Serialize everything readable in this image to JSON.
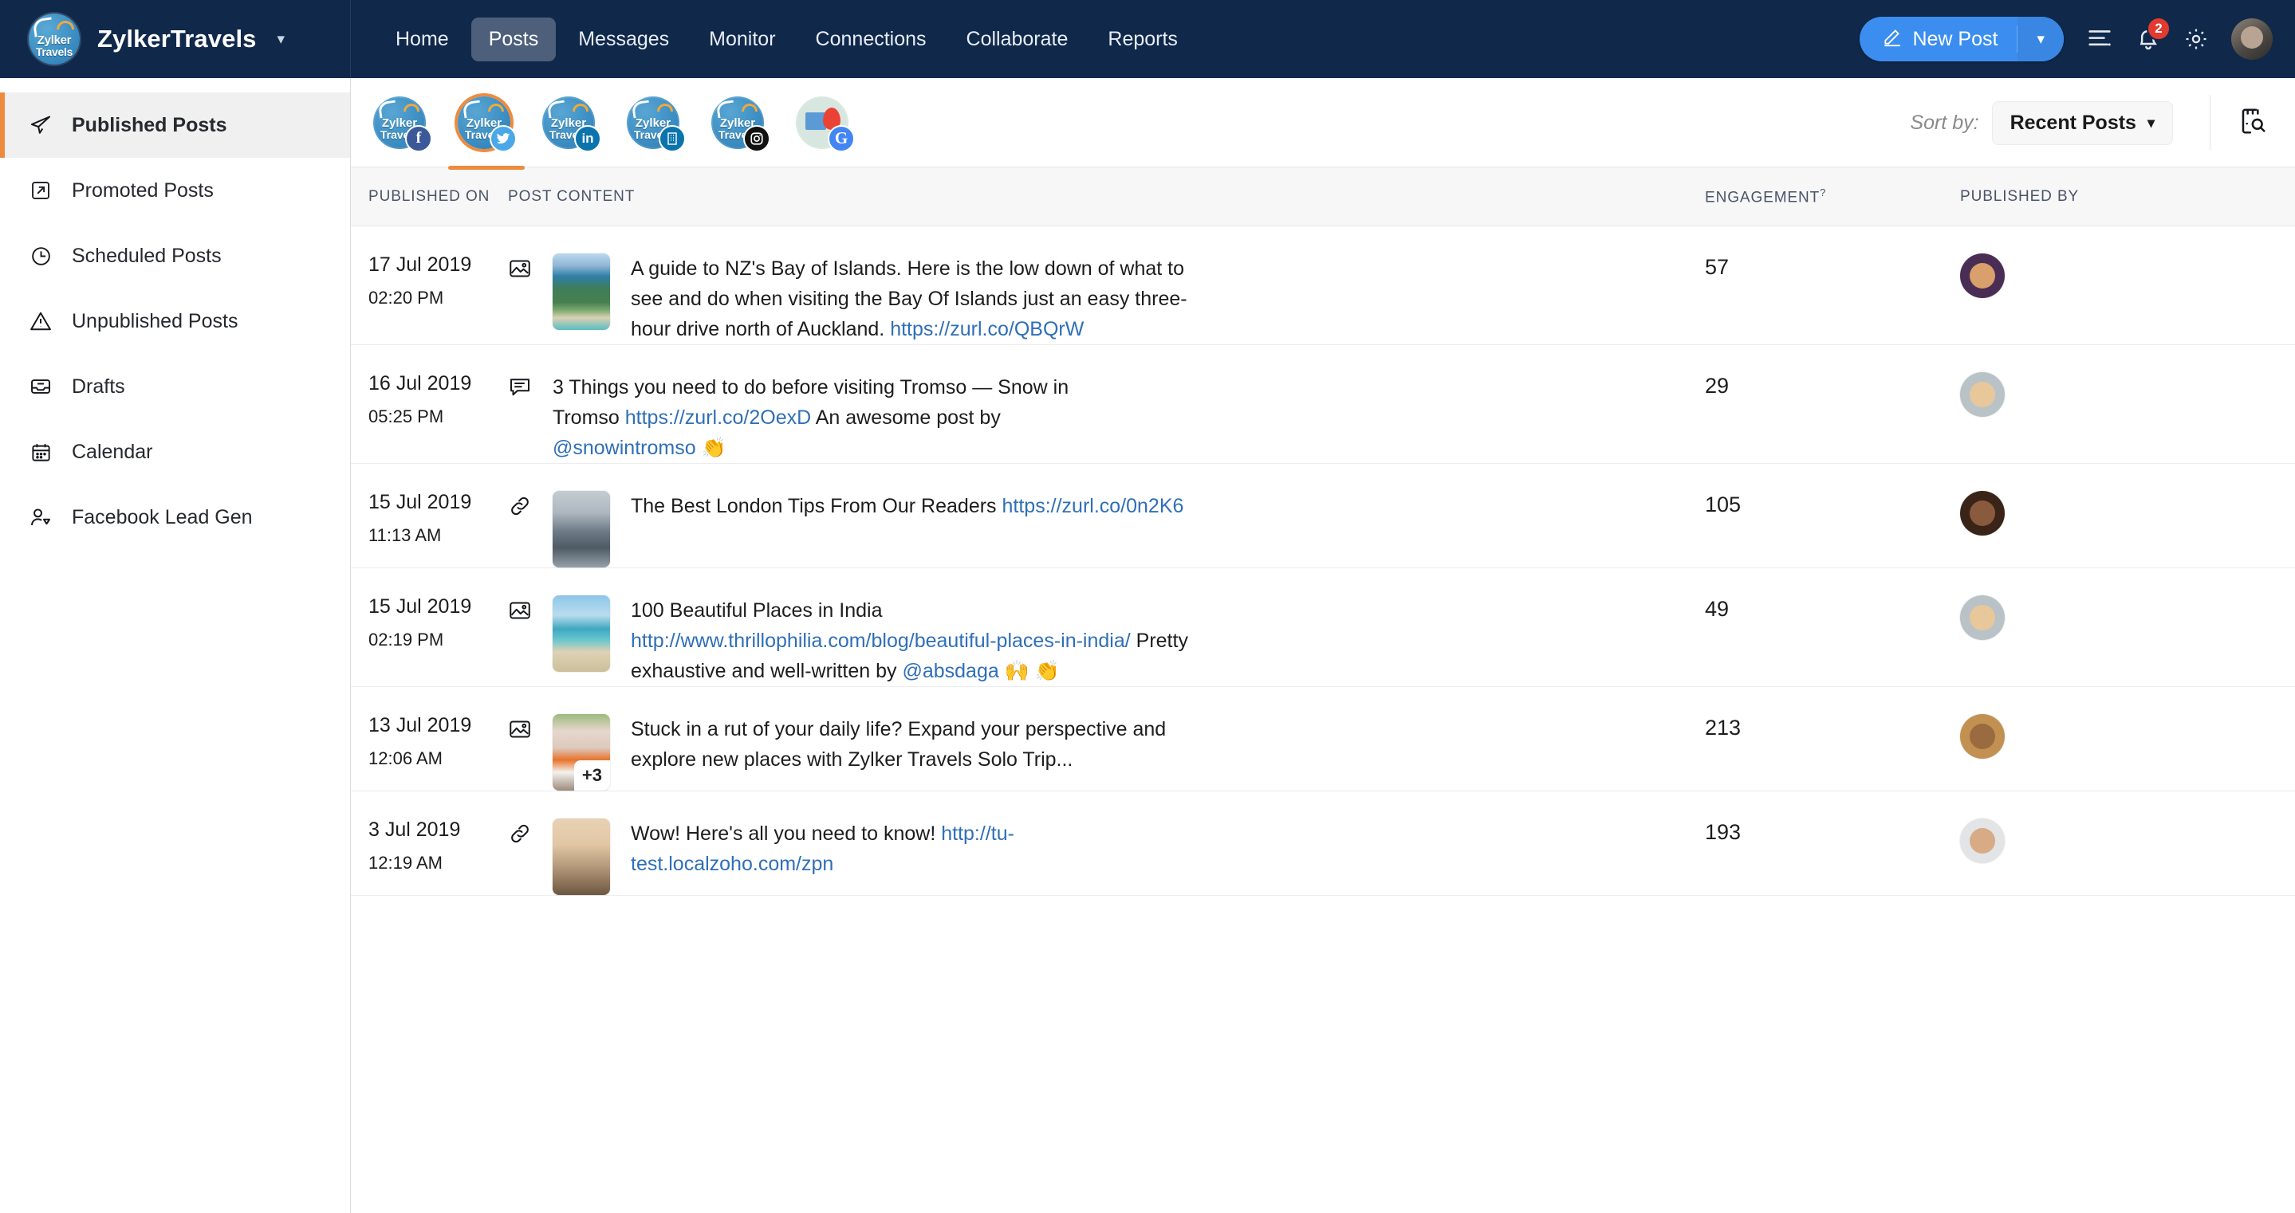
{
  "topbar": {
    "brand_name": "ZylkerTravels",
    "brand_logo_line1": "Zylker",
    "brand_logo_line2": "Travels",
    "brand_caret": "chevron-down-icon",
    "nav": [
      {
        "label": "Home",
        "active": false
      },
      {
        "label": "Posts",
        "active": true
      },
      {
        "label": "Messages",
        "active": false
      },
      {
        "label": "Monitor",
        "active": false
      },
      {
        "label": "Connections",
        "active": false
      },
      {
        "label": "Collaborate",
        "active": false
      },
      {
        "label": "Reports",
        "active": false
      }
    ],
    "new_post_label": "New Post",
    "notification_count": "2",
    "accent_blue": "#3b8ef0",
    "bar_color": "#10284a"
  },
  "sidebar": {
    "items": [
      {
        "label": "Published Posts",
        "icon": "paper-plane-icon",
        "active": true
      },
      {
        "label": "Promoted Posts",
        "icon": "external-link-box-icon",
        "active": false
      },
      {
        "label": "Scheduled Posts",
        "icon": "clock-icon",
        "active": false
      },
      {
        "label": "Unpublished Posts",
        "icon": "warning-triangle-icon",
        "active": false
      },
      {
        "label": "Drafts",
        "icon": "inbox-tray-icon",
        "active": false
      },
      {
        "label": "Calendar",
        "icon": "calendar-icon",
        "active": false
      },
      {
        "label": "Facebook Lead Gen",
        "icon": "user-add-icon",
        "active": false
      }
    ],
    "active_accent": "#ef8b3e"
  },
  "channels": [
    {
      "network": "facebook",
      "label_line1": "Zylker",
      "label_line2": "Travels",
      "selected": false,
      "glyph": "f",
      "color": "#3b5998"
    },
    {
      "network": "twitter",
      "label_line1": "Zylker",
      "label_line2": "Travels",
      "selected": true,
      "glyph": "ᴠ",
      "color": "#4aa8e8"
    },
    {
      "network": "linkedin",
      "label_line1": "Zylker",
      "label_line2": "Travels",
      "selected": false,
      "glyph": "in",
      "color": "#0c74ad"
    },
    {
      "network": "linkedin-page",
      "label_line1": "Zylker",
      "label_line2": "Travels",
      "selected": false,
      "glyph": "▒",
      "color": "#0c74ad"
    },
    {
      "network": "instagram",
      "label_line1": "Zylker",
      "label_line2": "Travels",
      "selected": false,
      "glyph": "◎",
      "color": "#111111"
    },
    {
      "network": "google-my-business",
      "label_line1": "",
      "label_line2": "",
      "selected": false,
      "glyph": "G",
      "color": "#4285f4"
    }
  ],
  "toolbar": {
    "sort_by_label": "Sort by:",
    "sort_value": "Recent Posts",
    "sort_caret": "chevron-down-icon",
    "search_posts_icon": "document-search-icon"
  },
  "table": {
    "headers": {
      "published_on": "PUBLISHED ON",
      "post_content": "POST CONTENT",
      "engagement": "ENGAGEMENT",
      "engagement_sup": "?",
      "published_by": "PUBLISHED BY"
    },
    "rows": [
      {
        "date": "17 Jul 2019",
        "time": "02:20 PM",
        "type_icon": "image-icon",
        "has_thumb": true,
        "thumb_kind": "bay-of-islands",
        "extra_count": "",
        "text_parts": [
          {
            "t": "A guide to NZ's Bay of Islands. Here is the low down of what to see and do when visiting the Bay Of Islands just an easy three-hour drive north of Auckland. ",
            "k": "plain"
          },
          {
            "t": "https://zurl.co/QBQrW",
            "k": "link"
          }
        ],
        "engagement": "57",
        "avatar_kind": "woman-curly"
      },
      {
        "date": "16 Jul 2019",
        "time": "05:25 PM",
        "type_icon": "text-bubble-icon",
        "has_thumb": false,
        "thumb_kind": "",
        "extra_count": "",
        "text_parts": [
          {
            "t": "3 Things you need to do before visiting Tromso — Snow in Tromso ",
            "k": "plain"
          },
          {
            "t": "https://zurl.co/2OexD",
            "k": "link"
          },
          {
            "t": " An awesome post by ",
            "k": "plain"
          },
          {
            "t": "@snowintromso",
            "k": "mention"
          },
          {
            "t": " 👏",
            "k": "plain"
          }
        ],
        "engagement": "29",
        "avatar_kind": "woman-blonde"
      },
      {
        "date": "15 Jul 2019",
        "time": "11:13 AM",
        "type_icon": "link-icon",
        "has_thumb": true,
        "thumb_kind": "london-skyline",
        "extra_count": "",
        "text_parts": [
          {
            "t": "The Best London Tips From Our Readers ",
            "k": "plain"
          },
          {
            "t": "https://zurl.co/0n2K6",
            "k": "link"
          }
        ],
        "engagement": "105",
        "avatar_kind": "man-dark"
      },
      {
        "date": "15 Jul 2019",
        "time": "02:19 PM",
        "type_icon": "image-icon",
        "has_thumb": true,
        "thumb_kind": "beach-india",
        "extra_count": "",
        "text_parts": [
          {
            "t": "100 Beautiful Places in India ",
            "k": "plain"
          },
          {
            "t": "http://www.thrillophilia.com/blog/beautiful-places-in-india/",
            "k": "link"
          },
          {
            "t": " Pretty exhaustive and well-written by ",
            "k": "plain"
          },
          {
            "t": "@absdaga",
            "k": "mention"
          },
          {
            "t": " 🙌 👏",
            "k": "plain"
          }
        ],
        "engagement": "49",
        "avatar_kind": "woman-blonde"
      },
      {
        "date": "13 Jul 2019",
        "time": "12:06 AM",
        "type_icon": "image-icon",
        "has_thumb": true,
        "thumb_kind": "orange-van",
        "extra_count": "+3",
        "text_parts": [
          {
            "t": "Stuck in a rut of your daily life? Expand your perspective and explore new places with Zylker Travels Solo Trip...",
            "k": "plain"
          }
        ],
        "engagement": "213",
        "avatar_kind": "man-computer"
      },
      {
        "date": "3 Jul 2019",
        "time": "12:19 AM",
        "type_icon": "link-icon",
        "has_thumb": true,
        "thumb_kind": "sepia-city",
        "extra_count": "",
        "text_parts": [
          {
            "t": "Wow! Here's all you need to know! ",
            "k": "plain"
          },
          {
            "t": "http://tu-test.localzoho.com/zpn",
            "k": "link"
          }
        ],
        "engagement": "193",
        "avatar_kind": "man-light"
      }
    ]
  }
}
